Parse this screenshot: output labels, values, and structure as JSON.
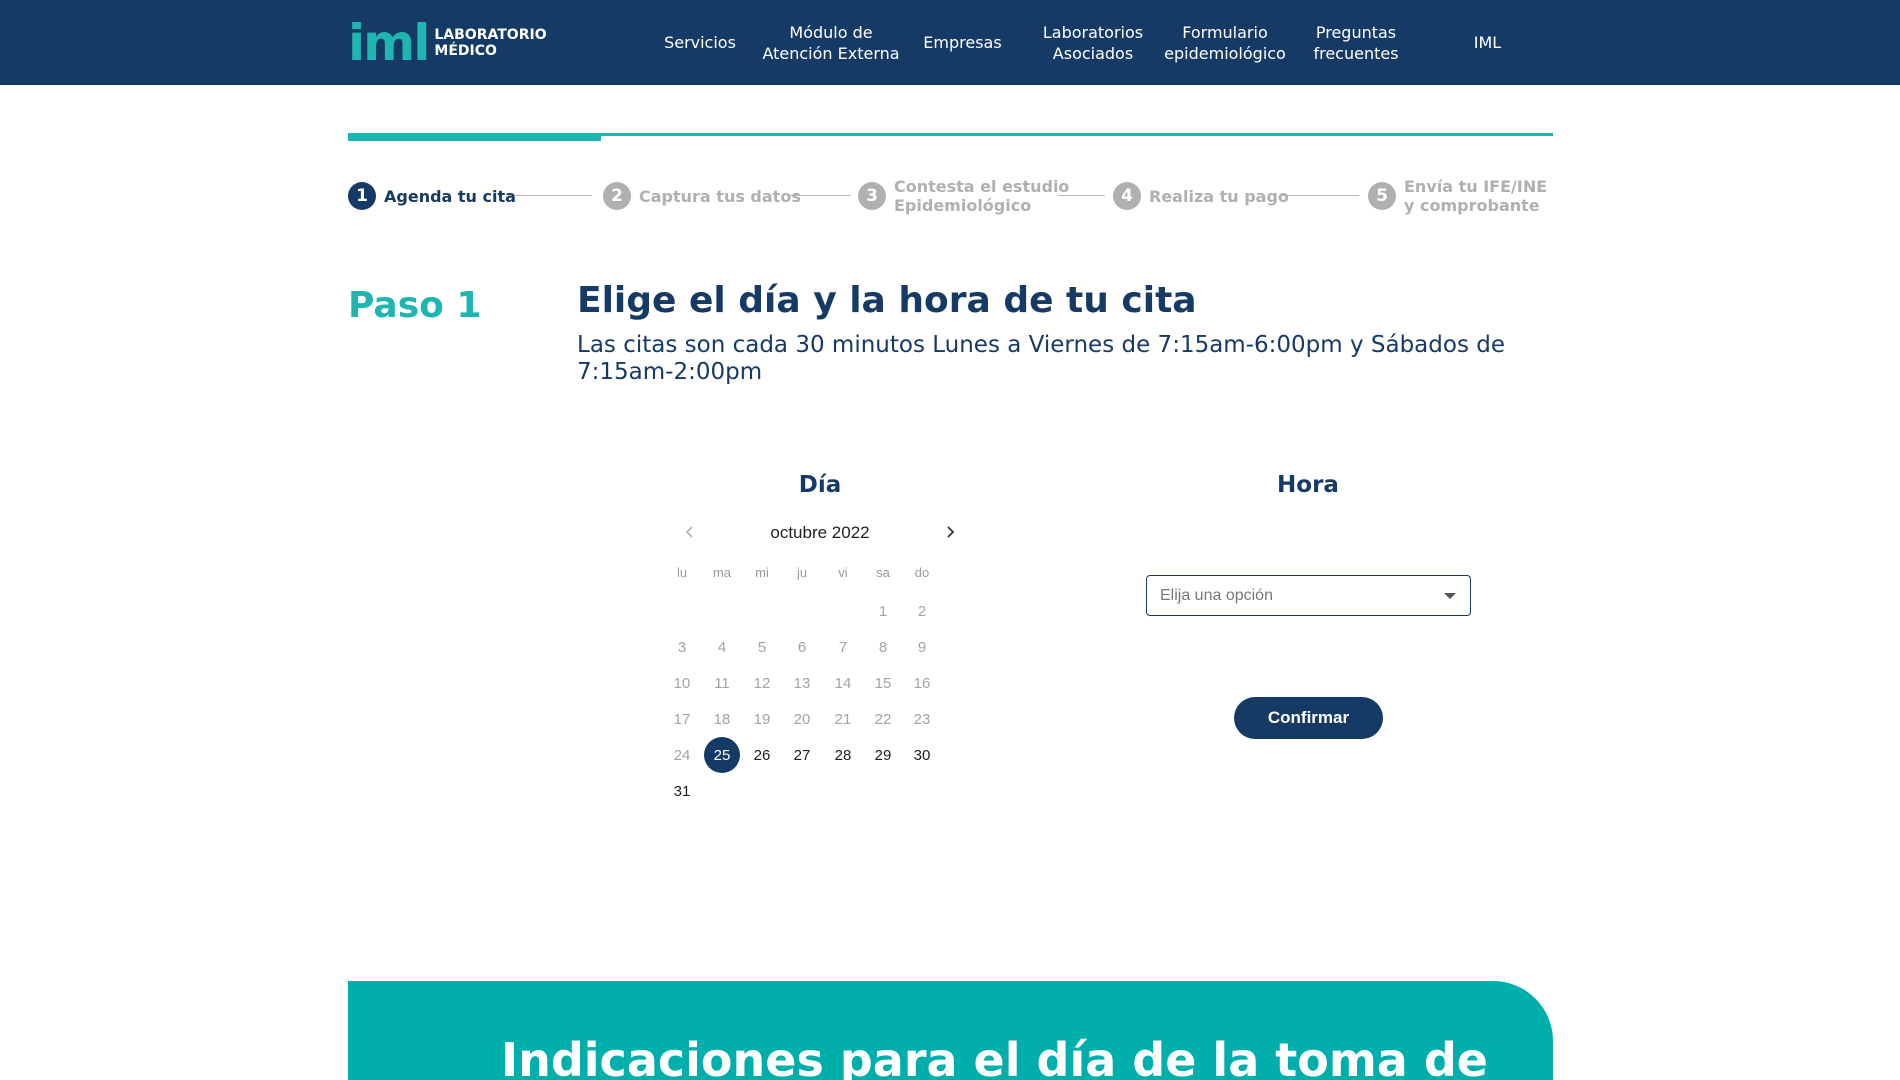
{
  "header": {
    "logo_mark": "iml",
    "logo_line1": "LABORATORIO",
    "logo_line2": "MÉDICO",
    "nav": [
      {
        "label": "Servicios"
      },
      {
        "label": "Módulo de\nAtención Externa"
      },
      {
        "label": "Empresas"
      },
      {
        "label": "Laboratorios\nAsociados"
      },
      {
        "label": "Formulario\nepidemiológico"
      },
      {
        "label": "Preguntas\nfrecuentes"
      },
      {
        "label": "IML"
      }
    ]
  },
  "progress": {
    "completed_fraction": 0.21
  },
  "steps": [
    {
      "number": "1",
      "label": "Agenda tu cita",
      "state": "active"
    },
    {
      "number": "2",
      "label": "Captura tus datos",
      "state": "inactive"
    },
    {
      "number": "3",
      "label": "Contesta el estudio\nEpidemiológico",
      "state": "inactive"
    },
    {
      "number": "4",
      "label": "Realiza tu pago",
      "state": "inactive"
    },
    {
      "number": "5",
      "label": "Envía tu IFE/INE\ny comprobante",
      "state": "inactive"
    }
  ],
  "paso": {
    "label": "Paso 1",
    "title": "Elige el día y la hora de tu cita",
    "subtitle": "Las citas son cada 30 minutos Lunes a Viernes de 7:15am-6:00pm y Sábados de 7:15am-2:00pm"
  },
  "calendar": {
    "title": "Día",
    "month": "octubre 2022",
    "prev_icon": "chevron-left-icon",
    "next_icon": "chevron-right-icon",
    "weekdays": [
      "lu",
      "ma",
      "mi",
      "ju",
      "vi",
      "sa",
      "do"
    ],
    "first_weekday_index": 5,
    "days_in_month": 31,
    "first_enabled_day": 25,
    "selected_day": 25
  },
  "hora": {
    "title": "Hora",
    "placeholder": "Elija una opción",
    "confirm_label": "Confirmar"
  },
  "indicaciones": {
    "title": "Indicaciones para el día de la toma de"
  },
  "colors": {
    "navy": "#163a66",
    "teal": "#1fb5b0",
    "banner_teal": "#00afac",
    "muted": "#b0b0b0"
  }
}
